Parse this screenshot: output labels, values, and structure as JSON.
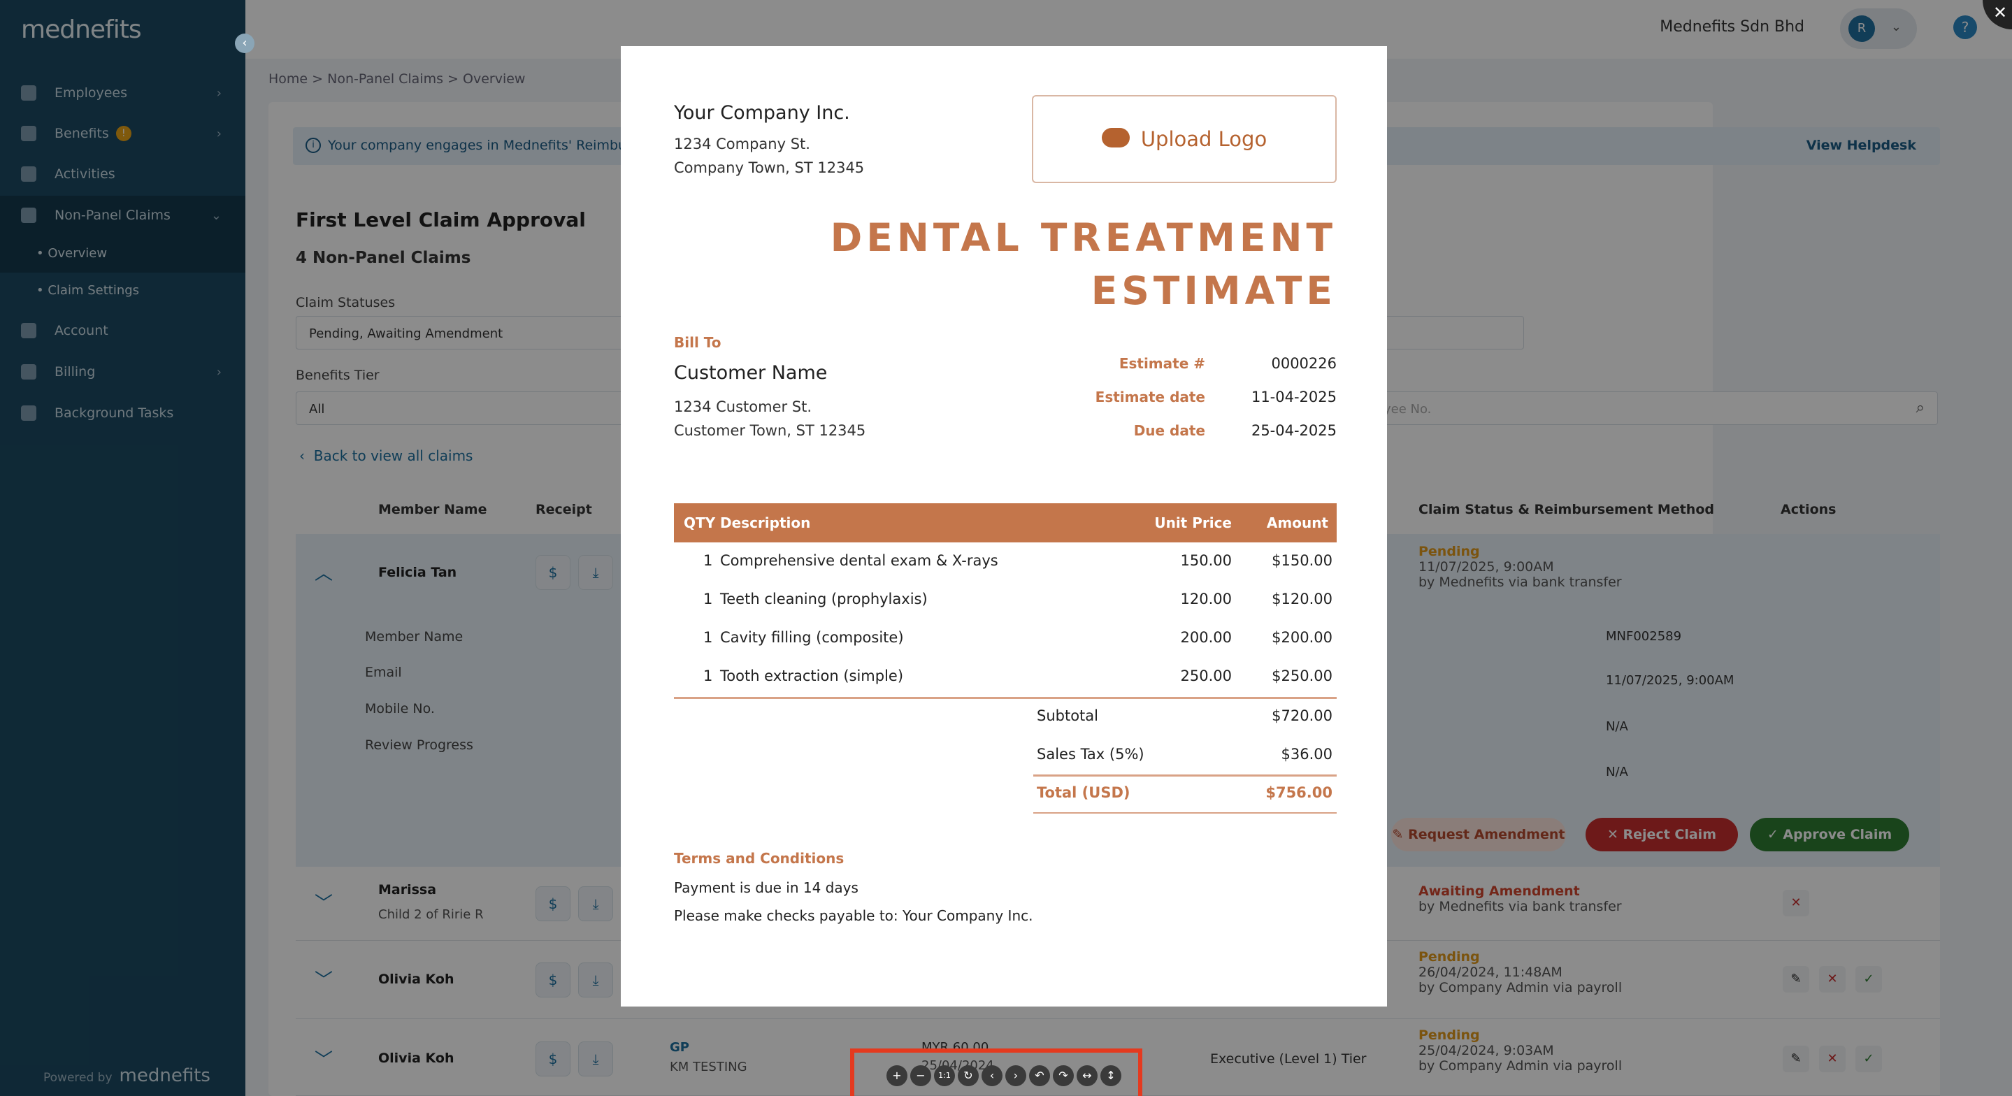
{
  "app": {
    "logo": "mednefits",
    "company": "Mednefits Sdn Bhd",
    "user_initial": "R",
    "help": "?",
    "collapse": "‹"
  },
  "sidebar": {
    "items": [
      {
        "label": "Employees",
        "chev": "›"
      },
      {
        "label": "Benefits",
        "badge": "!",
        "chev": "›"
      },
      {
        "label": "Activities"
      },
      {
        "label": "Non-Panel Claims",
        "chev": "⌄"
      },
      {
        "label": "Account"
      },
      {
        "label": "Billing",
        "chev": "›"
      },
      {
        "label": "Background Tasks"
      }
    ],
    "sub": [
      "Overview",
      "Claim Settings"
    ],
    "powered": "Powered by",
    "powered_brand": "mednefits"
  },
  "breadcrumb": "Home  >  Non-Panel Claims  >  Overview",
  "notice": {
    "text": "Your company engages in Mednefits' Reimburse",
    "link": "View Helpdesk",
    "icon": "i"
  },
  "page": {
    "title": "First Level Claim Approval",
    "count": "4 Non-Panel Claims",
    "back": "Back to view all claims"
  },
  "filters": {
    "status_label": "Claim Statuses",
    "status_value": "Pending, Awaiting Amendment",
    "tier_label": "Benefits Tier",
    "tier_value": "All",
    "search_placeholder": "yee No."
  },
  "table": {
    "headers": [
      "Member Name",
      "Receipt",
      "Claim Status & Reimbursement Method",
      "Actions"
    ]
  },
  "rows": [
    {
      "name": "Felicia Tan",
      "status": "Pending",
      "date": "11/07/2025, 9:00AM",
      "by": "by Mednefits via bank transfer"
    },
    {
      "name": "Marissa",
      "sub": "Child 2 of Ririe R",
      "status": "Awaiting Amendment",
      "by": "by Mednefits via bank transfer"
    },
    {
      "name": "Olivia Koh",
      "status": "Pending",
      "date": "26/04/2024, 11:48AM",
      "by": "by Company Admin via payroll"
    },
    {
      "name": "Olivia Koh",
      "status": "Pending",
      "date": "25/04/2024, 9:03AM",
      "by": "by Company Admin via payroll",
      "claim_type": "GP",
      "provider": "KM TESTING",
      "tier": "Executive (Level 1) Tier",
      "amount": "MYR 60.00",
      "claim_date": "25/04/2024"
    }
  ],
  "details": {
    "labels": [
      "Member Name",
      "Email",
      "Mobile No.",
      "Review Progress"
    ],
    "values": [
      "MNF002589",
      "11/07/2025, 9:00AM",
      "N/A",
      "N/A"
    ]
  },
  "actions": {
    "amend": "Request Amendment",
    "reject": "Reject Claim",
    "approve": "Approve Claim"
  },
  "doc": {
    "company": "Your Company Inc.",
    "addr1": "1234 Company St.",
    "addr2": "Company Town, ST 12345",
    "upload": "Upload Logo",
    "title1": "DENTAL TREATMENT",
    "title2": "ESTIMATE",
    "bill_to": "Bill To",
    "customer": "Customer Name",
    "caddr1": "1234 Customer St.",
    "caddr2": "Customer Town, ST 12345",
    "meta": [
      {
        "k": "Estimate #",
        "v": "0000226"
      },
      {
        "k": "Estimate date",
        "v": "11-04-2025"
      },
      {
        "k": "Due date",
        "v": "25-04-2025"
      }
    ],
    "cols": [
      "QTY",
      "Description",
      "Unit Price",
      "Amount"
    ],
    "items": [
      {
        "qty": "1",
        "desc": "Comprehensive dental exam & X-rays",
        "price": "150.00",
        "amt": "$150.00"
      },
      {
        "qty": "1",
        "desc": "Teeth cleaning (prophylaxis)",
        "price": "120.00",
        "amt": "$120.00"
      },
      {
        "qty": "1",
        "desc": "Cavity filling (composite)",
        "price": "200.00",
        "amt": "$200.00"
      },
      {
        "qty": "1",
        "desc": "Tooth extraction (simple)",
        "price": "250.00",
        "amt": "$250.00"
      }
    ],
    "subtotal_l": "Subtotal",
    "subtotal": "$720.00",
    "tax_l": "Sales Tax (5%)",
    "tax": "$36.00",
    "total_l": "Total (USD)",
    "total": "$756.00",
    "terms": "Terms and Conditions",
    "t1": "Payment is due in 14 days",
    "t2": "Please make checks payable to: Your Company Inc."
  },
  "viewer_tools": [
    "+",
    "−",
    "1:1",
    "↻",
    "‹",
    "›",
    "↶",
    "↷",
    "↔",
    "↕"
  ],
  "close": "✕",
  "colors": {
    "sidebar": "#1c4a63",
    "accent": "#c4764b",
    "pending": "#e09a1c",
    "reject": "#c62f2f",
    "approve": "#2e7d32"
  }
}
